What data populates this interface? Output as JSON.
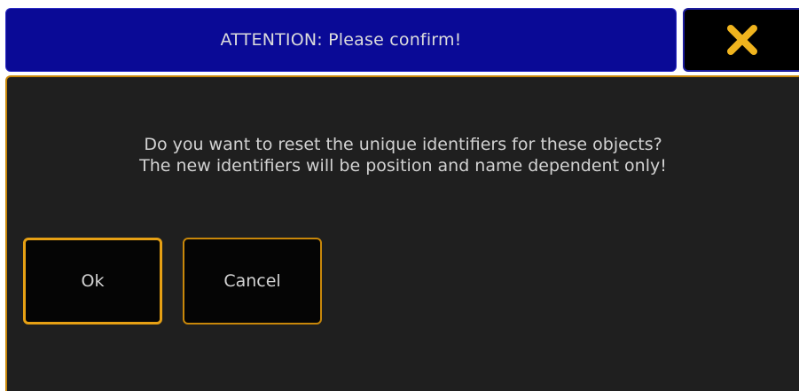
{
  "dialog": {
    "title": "ATTENTION: Please confirm!",
    "message_lines": [
      "Do you want to reset the unique identifiers for these objects?",
      "The new identifiers will be position and name dependent only!"
    ],
    "buttons": {
      "ok_label": "Ok",
      "cancel_label": "Cancel"
    },
    "close_icon": "close-x-icon"
  },
  "colors": {
    "title_bar": "#0a0a96",
    "close_icon": "#f0b41e",
    "body_background": "#1f1f1f",
    "accent_border": "#c8870a",
    "text": "#d2d2d2"
  }
}
